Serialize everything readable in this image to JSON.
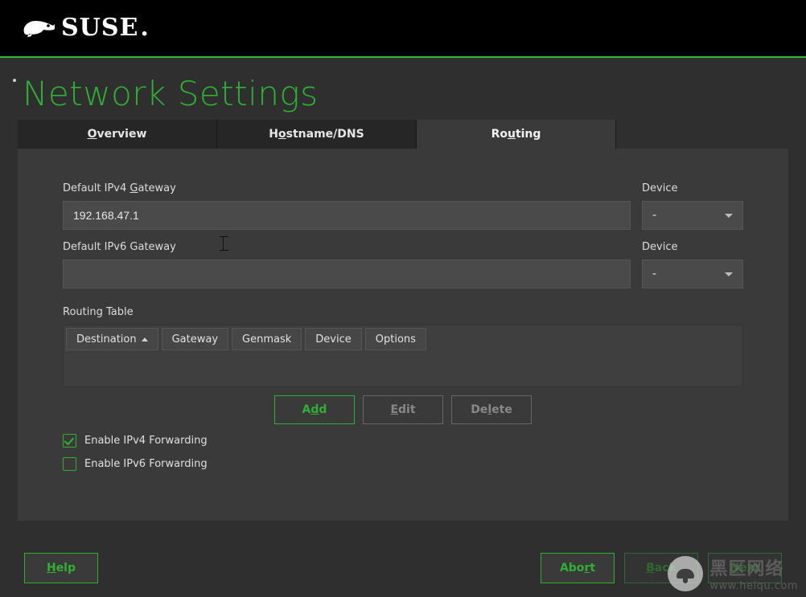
{
  "brand": {
    "name": "SUSE"
  },
  "page": {
    "title": "Network Settings"
  },
  "tabs": [
    {
      "label_pre": "",
      "label_ul": "O",
      "label_post": "verview",
      "active": false
    },
    {
      "label_pre": "H",
      "label_ul": "o",
      "label_post": "stname/DNS",
      "active": false
    },
    {
      "label_pre": "Ro",
      "label_ul": "u",
      "label_post": "ting",
      "active": true
    }
  ],
  "ipv4": {
    "label_pre": "Default IPv4 ",
    "label_ul": "G",
    "label_post": "ateway",
    "value": "192.168.47.1",
    "device_label": "Device",
    "device_value": "-"
  },
  "ipv6": {
    "label": "Default IPv6 Gateway",
    "value": "",
    "device_label": "Device",
    "device_value": "-"
  },
  "routing_table": {
    "label": "Routing Table",
    "columns": [
      "Destination",
      "Gateway",
      "Genmask",
      "Device",
      "Options"
    ],
    "sort_col": 0,
    "rows": []
  },
  "table_buttons": {
    "add_pre": "A",
    "add_ul": "d",
    "add_post": "d",
    "edit_pre": "",
    "edit_ul": "E",
    "edit_post": "dit",
    "delete_pre": "De",
    "delete_ul": "l",
    "delete_post": "ete"
  },
  "forwarding": {
    "ipv4": {
      "label_pre": "Enable ",
      "label_ul": "I",
      "label_post": "Pv4 Forwarding",
      "checked": true
    },
    "ipv6": {
      "label_pre": "Enable I",
      "label_ul": "P",
      "label_post": "v6 Forwarding",
      "checked": false
    }
  },
  "footer": {
    "help_pre": "",
    "help_ul": "H",
    "help_post": "elp",
    "abort_pre": "Abo",
    "abort_ul": "r",
    "abort_post": "t",
    "back_pre": "",
    "back_ul": "B",
    "back_post": "ack",
    "next_pre": "",
    "next_ul": "N",
    "next_post": "ext"
  },
  "watermark": {
    "text_cn": "黑区网络",
    "url": "www.heiqu.com"
  }
}
